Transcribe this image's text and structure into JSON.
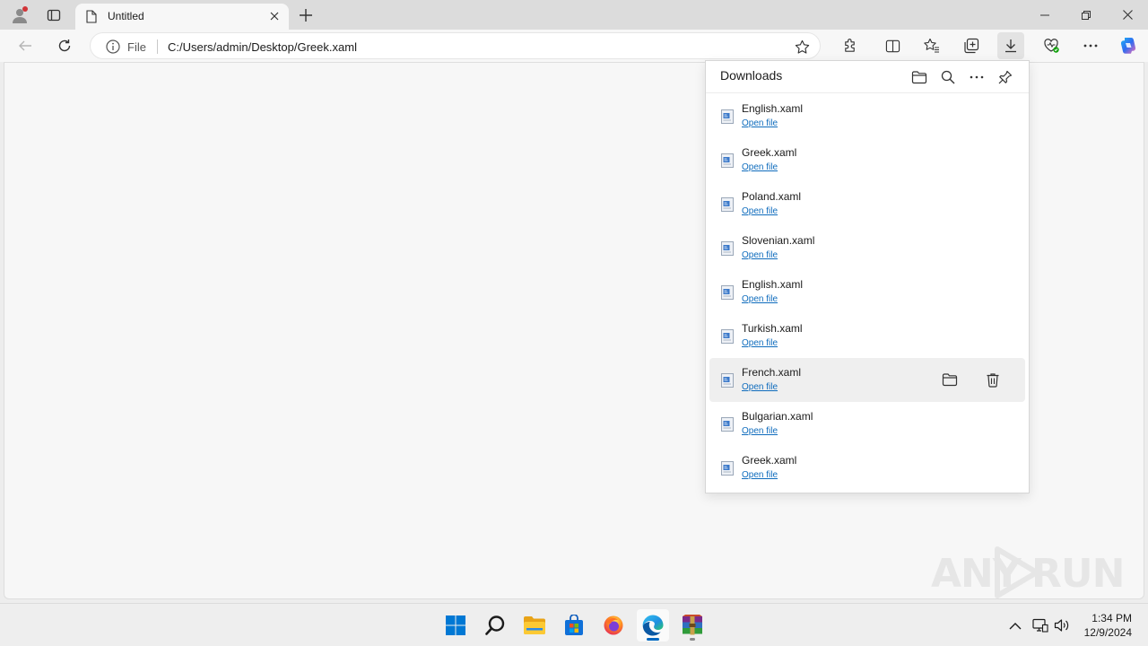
{
  "browser": {
    "tab": {
      "title": "Untitled"
    },
    "address": {
      "scheme_label": "File",
      "url": "C:/Users/admin/Desktop/Greek.xaml"
    }
  },
  "downloads": {
    "title": "Downloads",
    "open_label": "Open file",
    "items": [
      {
        "name": "English.xaml"
      },
      {
        "name": "Greek.xaml"
      },
      {
        "name": "Poland.xaml"
      },
      {
        "name": "Slovenian.xaml"
      },
      {
        "name": "English.xaml"
      },
      {
        "name": "Turkish.xaml"
      },
      {
        "name": "French.xaml"
      },
      {
        "name": "Bulgarian.xaml"
      },
      {
        "name": "Greek.xaml"
      }
    ]
  },
  "taskbar": {
    "time": "1:34 PM",
    "date": "12/9/2024"
  },
  "watermark": {
    "left": "ANY",
    "right": "RUN"
  },
  "colors": {
    "accent": "#0067c0",
    "link": "#0f6cbd",
    "hover_row": "#efefef"
  }
}
